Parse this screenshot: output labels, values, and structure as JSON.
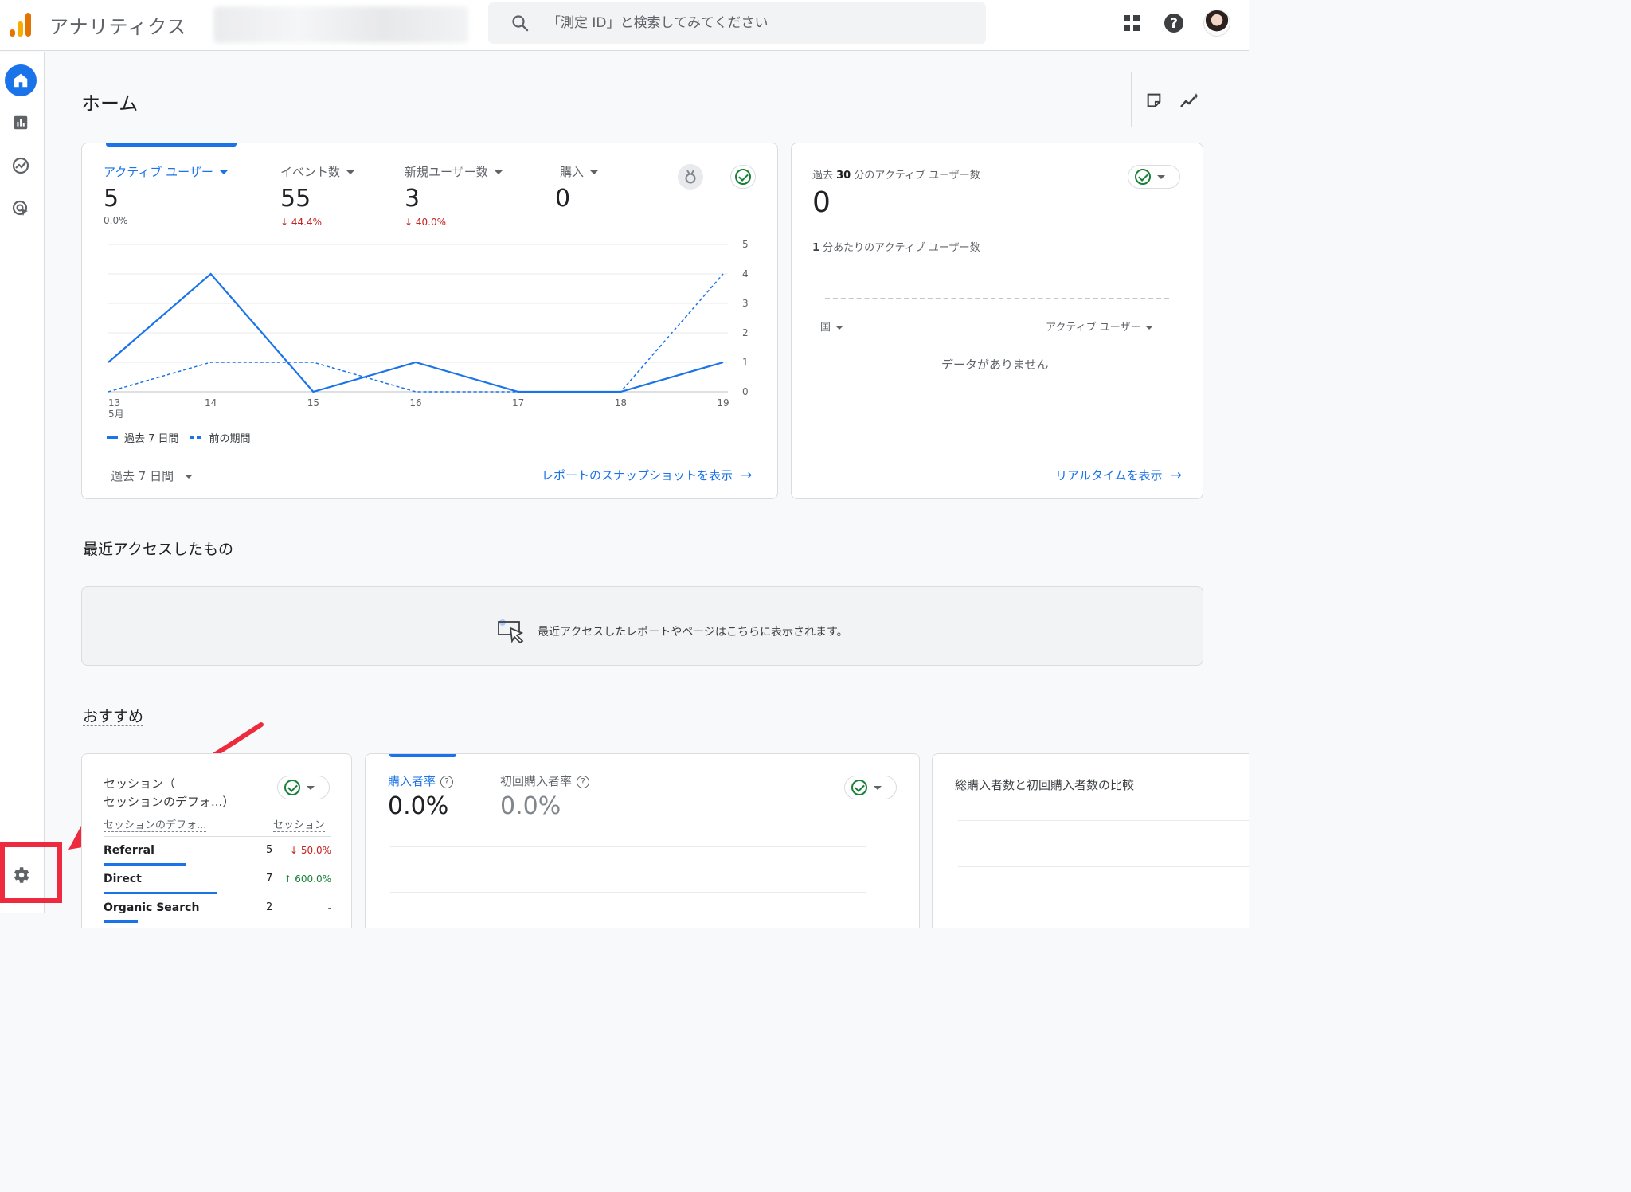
{
  "app": {
    "title": "アナリティクス"
  },
  "search": {
    "placeholder": "「測定 ID」と検索してみてください"
  },
  "page": {
    "title": "ホーム"
  },
  "overview": {
    "metrics": [
      {
        "label": "アクティブ ユーザー",
        "value": "5",
        "change": "0.0%"
      },
      {
        "label": "イベント数",
        "value": "55",
        "change": "↓ 44.4%"
      },
      {
        "label": "新規ユーザー数",
        "value": "3",
        "change": "↓ 40.0%"
      },
      {
        "label": "購入",
        "value": "0",
        "change": "-"
      }
    ],
    "legend_current": "過去 7 日間",
    "legend_previous": "前の期間",
    "date_range": "過去 7 日間",
    "snapshot_link": "レポートのスナップショットを表示"
  },
  "chart_data": {
    "type": "line",
    "x": [
      "13",
      "14",
      "15",
      "16",
      "17",
      "18",
      "19"
    ],
    "x_sublabel": "5月",
    "series": [
      {
        "name": "過去 7 日間",
        "values": [
          1,
          4,
          0,
          1,
          0,
          0,
          1
        ],
        "style": "solid"
      },
      {
        "name": "前の期間",
        "values": [
          0,
          1,
          1,
          0,
          0,
          0,
          4
        ],
        "style": "dashed"
      }
    ],
    "ylim": [
      0,
      5
    ],
    "yticks": [
      "0",
      "1",
      "2",
      "3",
      "4",
      "5"
    ],
    "y_axis_side": "right",
    "grid": true,
    "color": "#1a73e8"
  },
  "realtime": {
    "title_prefix": "過去 ",
    "title_bold": "30",
    "title_suffix": " 分のアクティブ ユーザー数",
    "value": "0",
    "per_minute_prefix": "1",
    "per_minute": " 分あたりのアクティブ ユーザー数",
    "col_country": "国",
    "col_users": "アクティブ ユーザー",
    "no_data": "データがありません",
    "link": "リアルタイムを表示"
  },
  "recent": {
    "title": "最近アクセスしたもの",
    "message": "最近アクセスしたレポートやページはこちらに表示されます。"
  },
  "recommended": {
    "title": "おすすめ",
    "sessions_card": {
      "title_line1": "セッション（",
      "title_line2": "セッションのデフォ...",
      "title_line2_suffix": "）",
      "col_dimension": "セッションのデフォ...",
      "col_sessions": "セッション",
      "rows": [
        {
          "name": "Referral",
          "value": "5",
          "change": "↓ 50.0%",
          "trend": "down",
          "bar": 0.36
        },
        {
          "name": "Direct",
          "value": "7",
          "change": "↑ 600.0%",
          "trend": "up",
          "bar": 0.5
        },
        {
          "name": "Organic Search",
          "value": "2",
          "change": "-",
          "trend": "none",
          "bar": 0.15
        }
      ]
    },
    "purchase_card": {
      "metric1_label": "購入者率",
      "metric1_value": "0.0%",
      "metric2_label": "初回購入者率",
      "metric2_value": "0.0%",
      "help": "?"
    },
    "compare_card": {
      "title": "総購入者数と初回購入者数の比較"
    }
  },
  "colors": {
    "accent": "#1a73e8",
    "down": "#c5221f",
    "up": "#188038",
    "annotation": "#ee2a3f"
  },
  "icons": [
    "analytics-logo",
    "search-icon",
    "apps-grid-icon",
    "help-icon",
    "avatar",
    "home-icon",
    "reports-icon",
    "explore-icon",
    "advertising-icon",
    "admin-gear-icon",
    "share-icon",
    "insights-icon",
    "check-circle-icon",
    "medal-icon",
    "cursor-icon",
    "arrow-right-icon"
  ]
}
